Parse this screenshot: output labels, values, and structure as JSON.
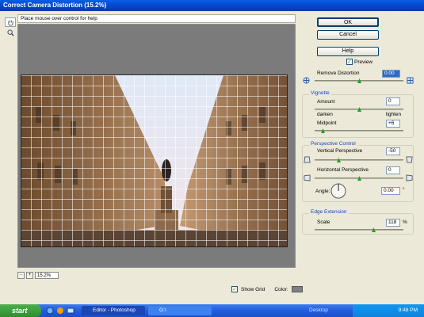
{
  "window": {
    "title": "Correct Camera Distortion (15.2%)"
  },
  "hint": "Place mouse over control for help",
  "buttons": {
    "ok": "OK",
    "cancel": "Cancel",
    "help": "Help"
  },
  "preview": {
    "label": "Preview",
    "checked": true
  },
  "remove_distortion": {
    "label": "Remove Distortion",
    "value": "0.00"
  },
  "vignette": {
    "title": "Vignette",
    "amount_label": "Amount",
    "amount_value": "0",
    "darken": "darken",
    "lighten": "lighten",
    "midpoint_label": "Midpoint",
    "midpoint_value": "+6"
  },
  "perspective": {
    "title": "Perspective Control",
    "vertical_label": "Vertical Perspective",
    "vertical_value": "-50",
    "horizontal_label": "Horizontal Perspective",
    "horizontal_value": "0",
    "angle_label": "Angle:",
    "angle_value": "0.00",
    "angle_unit": "°"
  },
  "edge": {
    "title": "Edge Extension",
    "scale_label": "Scale",
    "scale_value": "118",
    "scale_unit": "%"
  },
  "zoom": {
    "minus": "-",
    "plus": "+",
    "value": "15.2%"
  },
  "options": {
    "show_grid": "Show Grid",
    "color_label": "Color:",
    "grid_color": "#808080"
  },
  "taskbar": {
    "start": "start",
    "task1": "Editor - Photoshop El...",
    "task2": "G:\\",
    "desktop": "Desktop",
    "time": "9:48 PM"
  }
}
